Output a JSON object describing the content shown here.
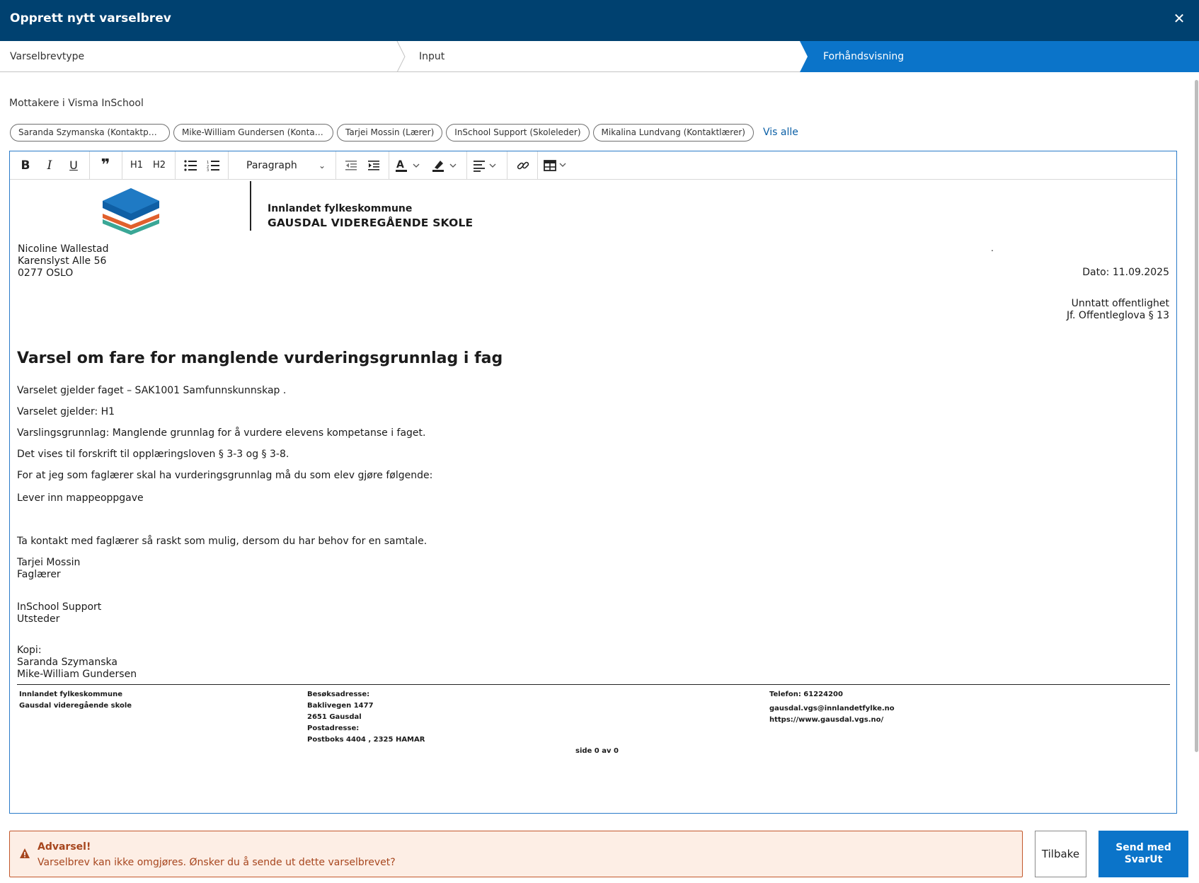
{
  "window": {
    "title": "Opprett nytt varselbrev",
    "close_glyph": "✕"
  },
  "stepper": {
    "steps": [
      {
        "label": "Varselbrevtype",
        "active": false
      },
      {
        "label": "Input",
        "active": false
      },
      {
        "label": "Forhåndsvisning",
        "active": true
      }
    ]
  },
  "recipients": {
    "label": "Mottakere i Visma InSchool",
    "chips": [
      "Saranda Szymanska (Kontaktperson)",
      "Mike-William Gundersen (Kontaktperson)",
      "Tarjei Mossin (Lærer)",
      "InSchool Support (Skoleleder)",
      "Mikalina Lundvang (Kontaktlærer)"
    ],
    "show_all": "Vis alle"
  },
  "toolbar": {
    "bold": "B",
    "italic": "I",
    "underline": "U",
    "quote": "❞",
    "h1": "H1",
    "h2": "H2",
    "paragraph": "Paragraph",
    "icons": [
      "bold-icon",
      "italic-icon",
      "underline-icon",
      "quote-icon",
      "bullet-list-icon",
      "numbered-list-icon",
      "outdent-icon",
      "indent-icon",
      "text-color-icon",
      "highlight-icon",
      "align-icon",
      "link-icon",
      "table-icon"
    ]
  },
  "letter": {
    "org_name": "Innlandet fylkeskommune",
    "school_name": "GAUSDAL VIDEREGÅENDE SKOLE",
    "recipient": [
      "Nicoline Wallestad",
      "Karenslyst Alle 56",
      "0277 OSLO"
    ],
    "dot": ".",
    "date": "Dato: 11.09.2025",
    "classification": [
      "Unntatt offentlighet",
      "Jf. Offentleglova § 13"
    ],
    "title": "Varsel om fare for manglende vurderingsgrunnlag i fag",
    "paragraphs": [
      "Varselet gjelder faget – SAK1001 Samfunnskunnskap .",
      "Varselet gjelder: H1",
      "Varslingsgrunnlag: Manglende grunnlag for å vurdere elevens kompetanse i faget.",
      "Det vises til forskrift til opplæringsloven § 3-3 og § 3-8.",
      "For at jeg som faglærer skal ha vurderingsgrunnlag må du som elev gjøre følgende:",
      "Lever inn mappeoppgave",
      "Ta kontakt med faglærer så raskt som mulig, dersom du har behov for en samtale."
    ],
    "signer": [
      "Tarjei Mossin",
      "Faglærer"
    ],
    "issuer": [
      "InSchool Support",
      "Utsteder"
    ],
    "copy_label": "Kopi:",
    "copy": [
      "Saranda Szymanska",
      "Mike-William Gundersen"
    ],
    "footer": {
      "col1": [
        "Innlandet fylkeskommune",
        "Gausdal videregående skole"
      ],
      "col2": [
        "Besøksadresse:",
        "Baklivegen 1477",
        "2651 Gausdal",
        "Postadresse:",
        "Postboks 4404 , 2325 HAMAR"
      ],
      "col3": [
        "Telefon: 61224200",
        "gausdal.vgs@innlandetfylke.no",
        "https://www.gausdal.vgs.no/"
      ],
      "page": "side 0 av 0"
    }
  },
  "warning": {
    "title": "Advarsel!",
    "message": "Varselbrev kan ikke omgjøres. Ønsker du å sende ut dette varselbrevet?"
  },
  "actions": {
    "back": "Tilbake",
    "send": "Send med SvarUt"
  },
  "colors": {
    "header": "#004170",
    "accent": "#0b74c9",
    "warning_text": "#a7461e",
    "warning_bg": "#fdeee5"
  }
}
